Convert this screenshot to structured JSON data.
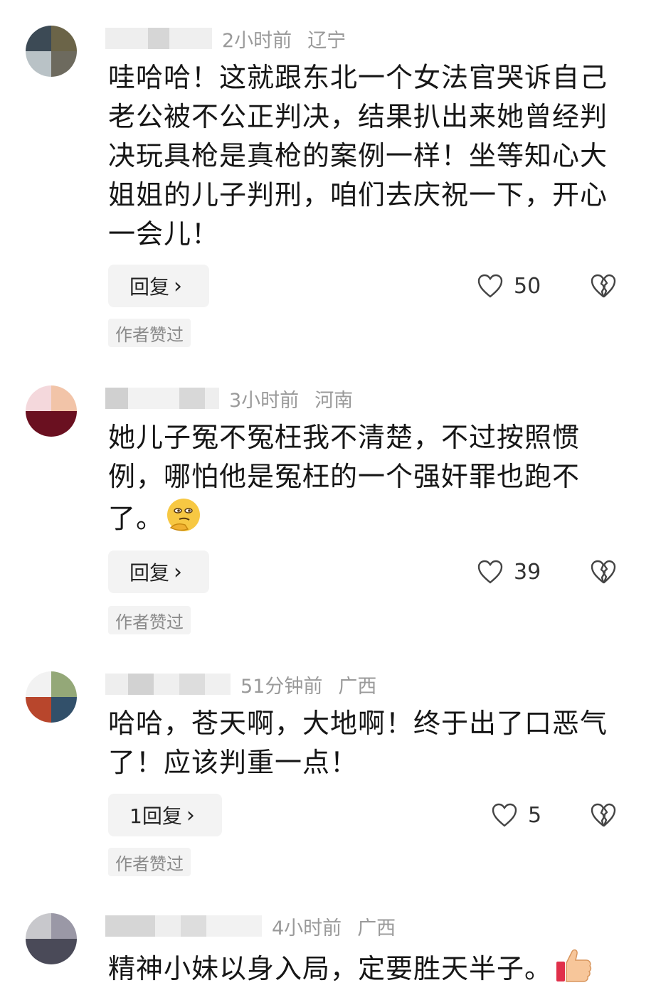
{
  "comments": [
    {
      "time": "2小时前",
      "location": "辽宁",
      "text": "哇哈哈！这就跟东北一个女法官哭诉自己老公被不公正判决，结果扒出来她曾经判决玩具枪是真枪的案例一样！坐等知心大姐姐的儿子判刑，咱们去庆祝一下，开心一会儿！",
      "reply_label": "回复",
      "likes": "50",
      "author_badge": "作者赞过"
    },
    {
      "time": "3小时前",
      "location": "河南",
      "text": "她儿子冤不冤枉我不清楚，不过按照惯例，哪怕他是冤枉的一个强奸罪也跑不了。",
      "emoji": "thinking-face-emoji",
      "reply_label": "回复",
      "likes": "39",
      "author_badge": "作者赞过"
    },
    {
      "time": "51分钟前",
      "location": "广西",
      "text": "哈哈，苍天啊，大地啊！终于出了口恶气了！应该判重一点！",
      "reply_label": "1回复",
      "likes": "5",
      "author_badge": "作者赞过"
    },
    {
      "time": "4小时前",
      "location": "广西",
      "text": "精神小妹以身入局，定要胜天半子。",
      "emoji": "thumbs-up-emoji"
    }
  ],
  "colors": {
    "text": "#161616",
    "meta": "#9a9a9a",
    "button_bg": "#f3f3f3"
  },
  "icons": [
    "heart-outline-icon",
    "broken-heart-icon",
    "chevron-right-icon"
  ]
}
